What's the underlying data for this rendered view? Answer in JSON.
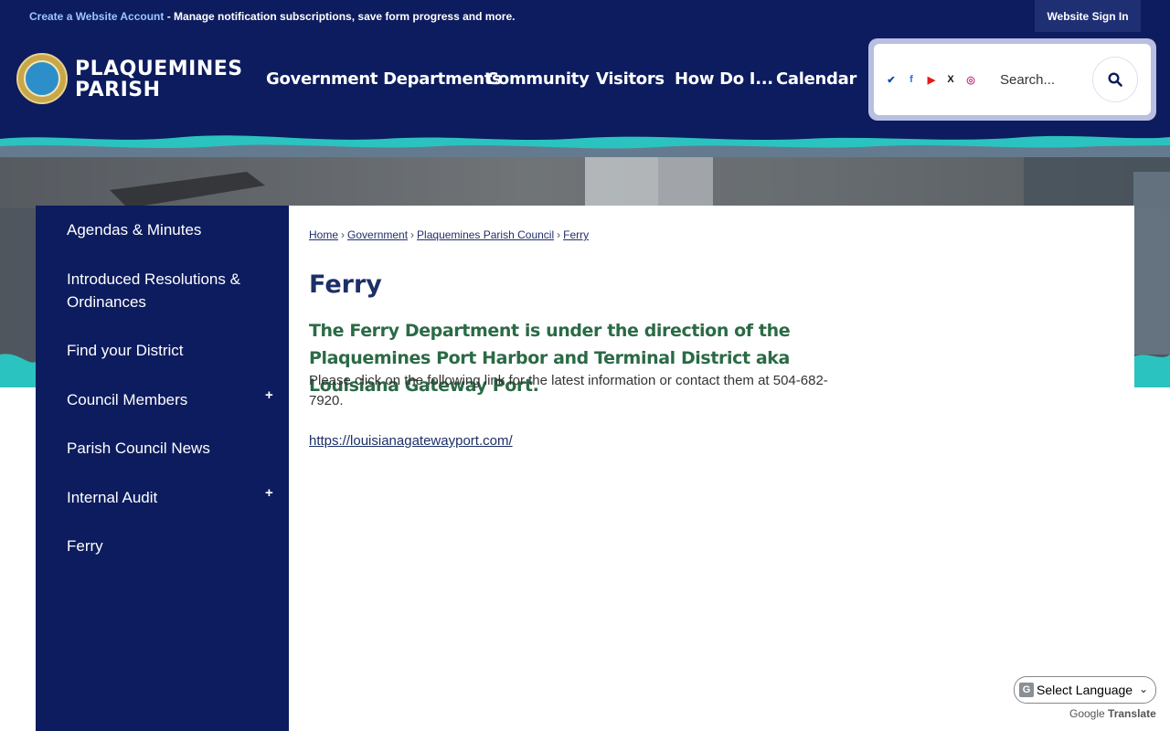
{
  "topbar": {
    "create_account": "Create a Website Account",
    "message": " - Manage notification subscriptions, save form progress and more.",
    "sign_in": "Website Sign In"
  },
  "brand": {
    "line1": "PLAQUEMINES",
    "line2": "PARISH"
  },
  "nav": [
    "Government Departments",
    "Community",
    "Visitors",
    "How Do I...",
    "Calendar"
  ],
  "social": [
    {
      "icon": "nextdoor-icon",
      "glyph": "✔",
      "color": "#0b4aa8"
    },
    {
      "icon": "facebook-icon",
      "glyph": "f",
      "color": "#1877f2"
    },
    {
      "icon": "youtube-icon",
      "glyph": "▶",
      "color": "#e31b1b"
    },
    {
      "icon": "x-icon",
      "glyph": "X",
      "color": "#111111"
    },
    {
      "icon": "instagram-icon",
      "glyph": "◎",
      "color": "#c13584"
    }
  ],
  "search": {
    "placeholder": "Search..."
  },
  "sidebar": {
    "items": [
      {
        "label": "Agendas & Minutes",
        "expandable": false
      },
      {
        "label": "Introduced Resolutions & Ordinances",
        "expandable": false
      },
      {
        "label": "Find your District",
        "expandable": false
      },
      {
        "label": "Council Members",
        "expandable": true
      },
      {
        "label": "Parish Council News",
        "expandable": false
      },
      {
        "label": "Internal Audit",
        "expandable": true
      },
      {
        "label": "Ferry",
        "expandable": false
      }
    ],
    "expand_symbol": "+"
  },
  "breadcrumb": [
    "Home",
    "Government",
    "Plaquemines Parish Council",
    "Ferry"
  ],
  "breadcrumb_sep": "›",
  "page": {
    "title": "Ferry",
    "lead": "The Ferry Department is under the direction of the Plaquemines Port Harbor and Terminal District aka Louisiana Gateway Port.",
    "body": "Please click on the following  link for the latest information or contact them at 504-682-7920.",
    "link": "https://louisianagatewayport.com/"
  },
  "translate": {
    "select_label": "Select Language",
    "powered_by": "Google",
    "translate_label": "Translate"
  },
  "colors": {
    "navy": "#0c1c5e",
    "teal": "#2bc3c0",
    "title": "#1c2f67",
    "lead_green": "#2b6a46"
  }
}
